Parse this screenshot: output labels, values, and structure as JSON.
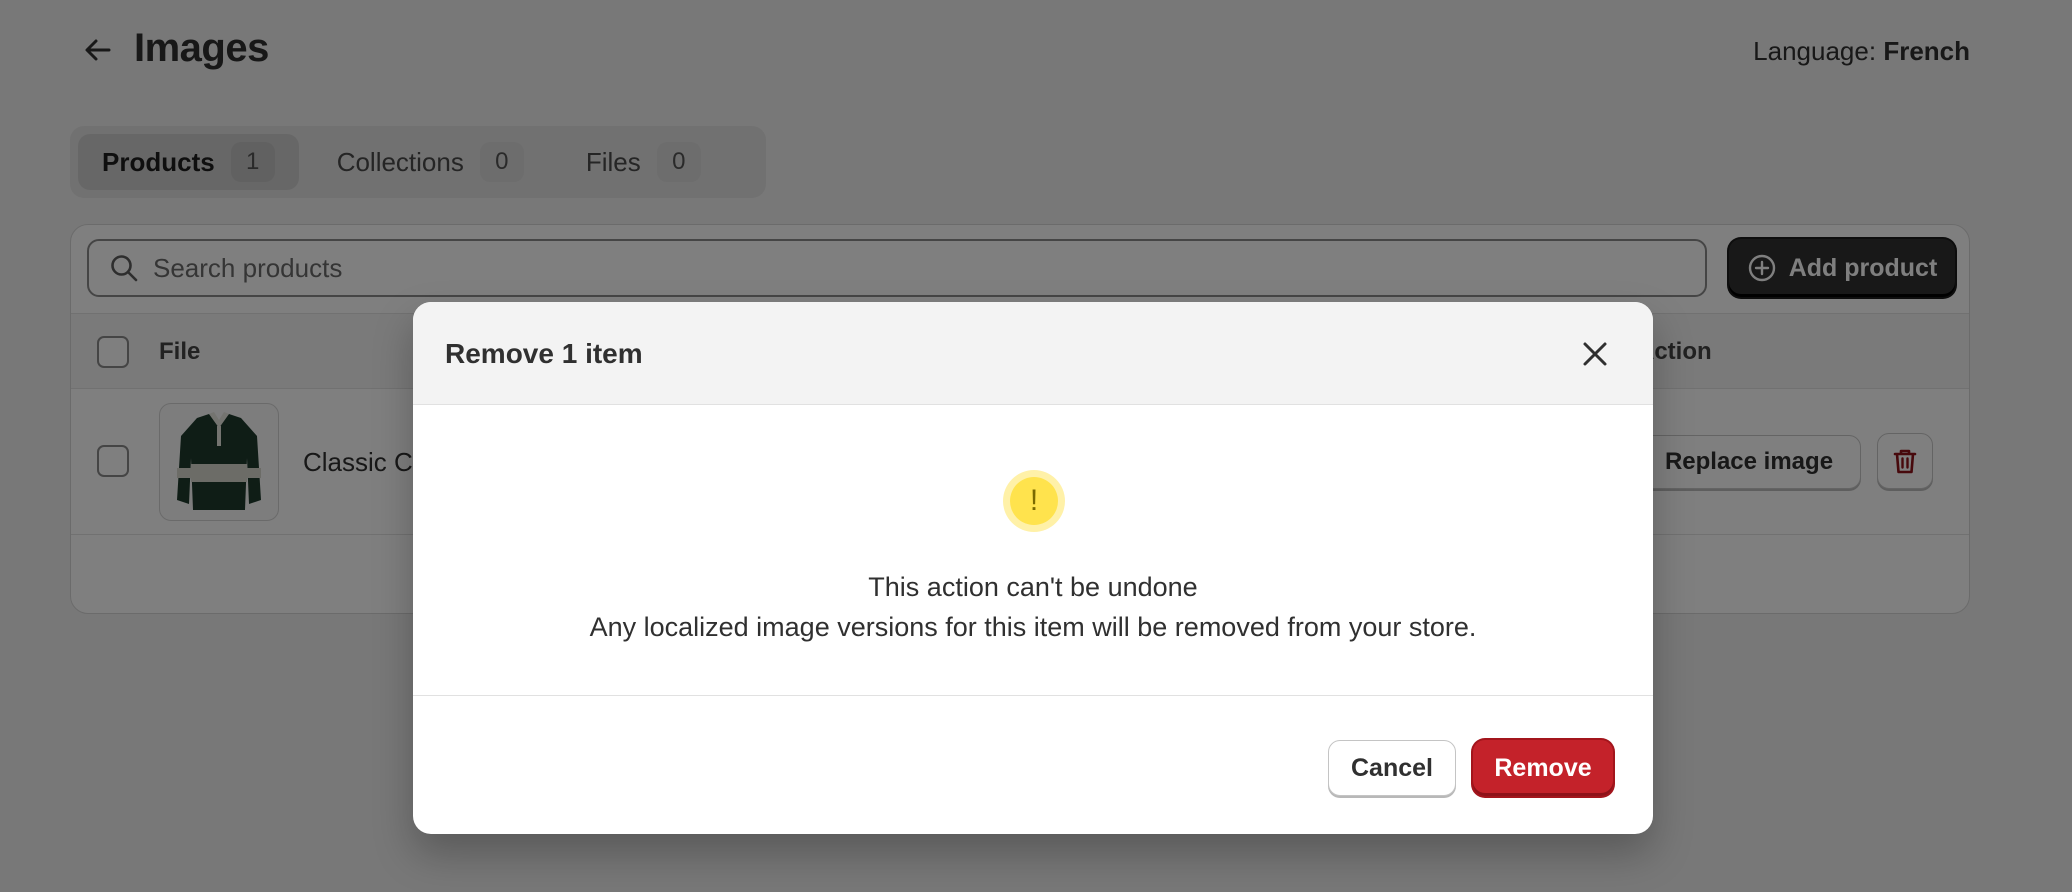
{
  "header": {
    "title": "Images",
    "language_label": "Language:",
    "language_value": "French"
  },
  "tabs": [
    {
      "label": "Products",
      "count": "1"
    },
    {
      "label": "Collections",
      "count": "0"
    },
    {
      "label": "Files",
      "count": "0"
    }
  ],
  "toolbar": {
    "search_placeholder": "Search products",
    "add_label": "Add product"
  },
  "table": {
    "col_file": "File",
    "col_action": "Action",
    "rows": [
      {
        "name": "Classic C",
        "replace_label": "Replace image"
      }
    ]
  },
  "modal": {
    "title": "Remove 1 item",
    "message_line1": "This action can't be undone",
    "message_line2": "Any localized image versions for this item will be removed from your store.",
    "cancel_label": "Cancel",
    "remove_label": "Remove"
  },
  "colors": {
    "overlay": "#000000",
    "primary_dark": "#303030",
    "destructive": "#c4222a",
    "warning": "#ffe34d"
  },
  "icons": {
    "back": "arrow-left-icon",
    "search": "search-icon",
    "add": "plus-circle-icon",
    "delete": "trash-icon",
    "close": "close-icon",
    "warning": "exclamation-icon"
  }
}
